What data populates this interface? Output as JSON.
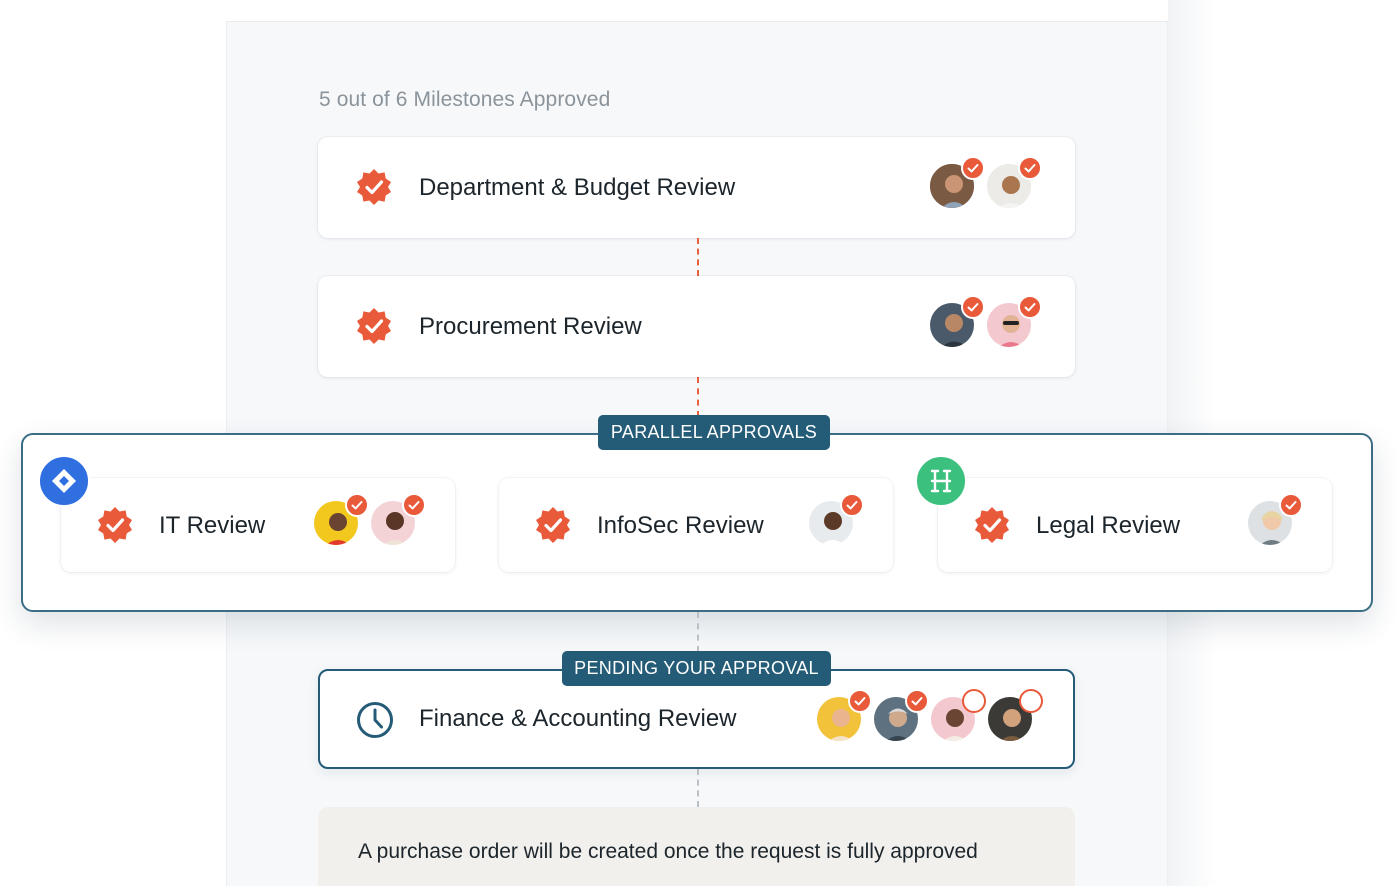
{
  "progress": {
    "text": "5 out of 6 Milestones Approved",
    "approved": 5,
    "total": 6
  },
  "milestones": {
    "department": {
      "title": "Department & Budget Review",
      "status": "approved",
      "approvers": [
        "approved",
        "approved"
      ]
    },
    "procurement": {
      "title": "Procurement Review",
      "status": "approved",
      "approvers": [
        "approved",
        "approved"
      ]
    },
    "it": {
      "title": "IT Review",
      "status": "approved",
      "approvers": [
        "approved",
        "approved"
      ],
      "app_icon": "diamond-icon"
    },
    "infosec": {
      "title": "InfoSec Review",
      "status": "approved",
      "approvers": [
        "approved"
      ]
    },
    "legal": {
      "title": "Legal Review",
      "status": "approved",
      "approvers": [
        "approved"
      ],
      "app_icon": "bracket-logo-icon"
    },
    "finance": {
      "title": "Finance & Accounting Review",
      "status": "pending",
      "approvers": [
        "approved",
        "approved",
        "pending",
        "pending"
      ]
    }
  },
  "tags": {
    "parallel": "PARALLEL APPROVALS",
    "pending": "PENDING YOUR APPROVAL"
  },
  "footer": {
    "note": "A purchase order will be created once the request is fully approved"
  },
  "colors": {
    "accent_orange": "#e85a3a",
    "tag_blue": "#245b77",
    "app_blue": "#2f6fdf",
    "app_green": "#3cc07d"
  }
}
